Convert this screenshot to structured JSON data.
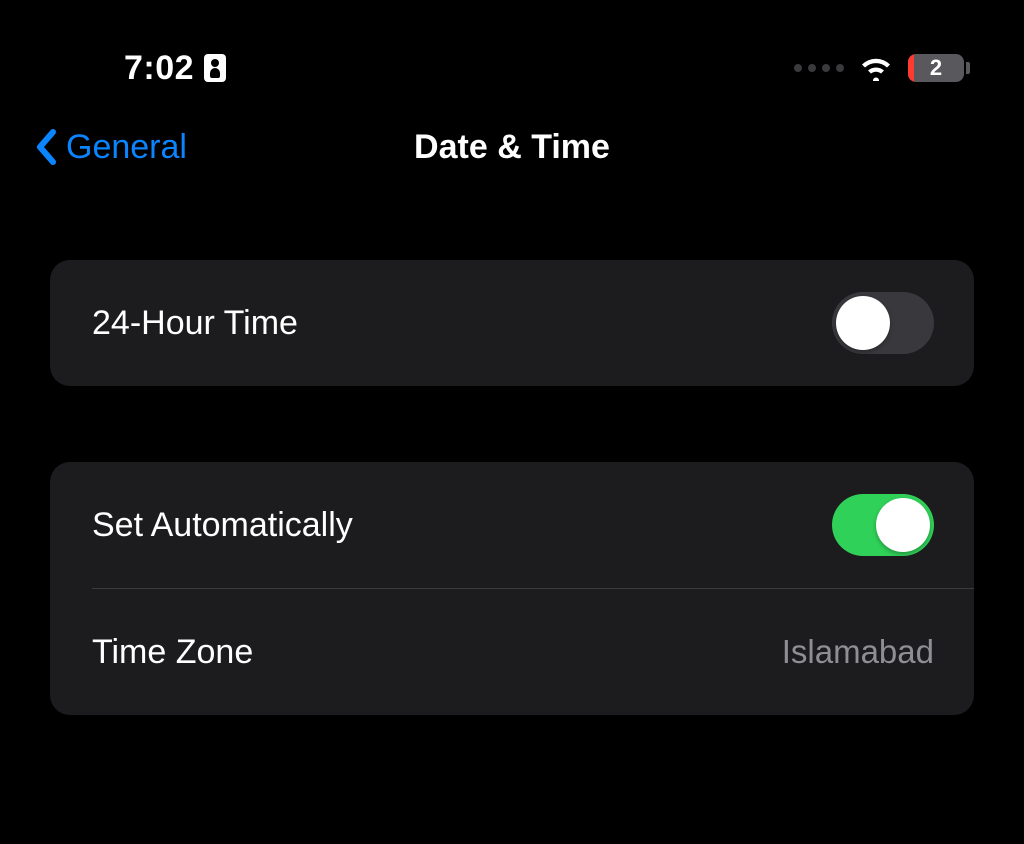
{
  "status": {
    "time": "7:02",
    "battery_text": "2"
  },
  "nav": {
    "back_label": "General",
    "title": "Date & Time"
  },
  "group1": {
    "row24h_label": "24-Hour Time",
    "row24h_on": false
  },
  "group2": {
    "auto_label": "Set Automatically",
    "auto_on": true,
    "tz_label": "Time Zone",
    "tz_value": "Islamabad"
  }
}
